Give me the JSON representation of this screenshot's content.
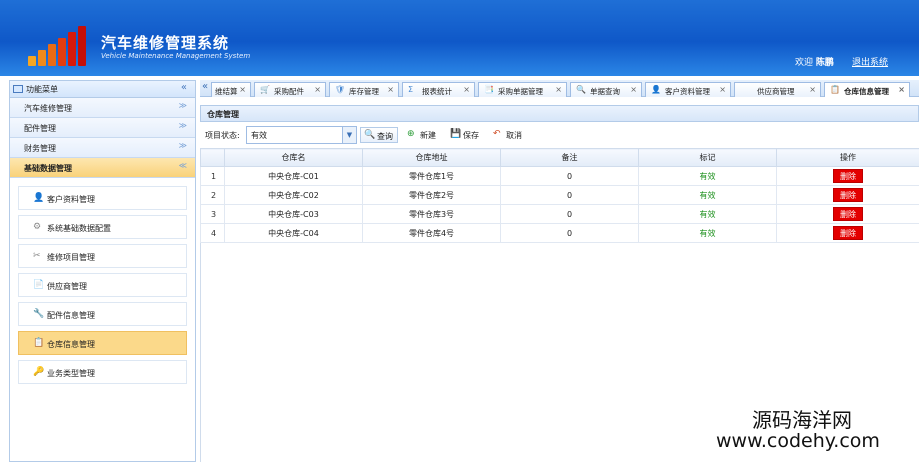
{
  "header": {
    "title_cn": "汽车维修管理系统",
    "title_en": "Vehicle Maintenance Management System",
    "welcome_prefix": "欢迎",
    "user": "陈鹏",
    "logout": "退出系统"
  },
  "sidebar": {
    "title": "功能菜单",
    "collapse": "«",
    "categories": [
      {
        "label": "汽车维修管理",
        "chev": "≫"
      },
      {
        "label": "配件管理",
        "chev": "≫"
      },
      {
        "label": "财务管理",
        "chev": "≫"
      },
      {
        "label": "基础数据管理",
        "chev": "≪"
      }
    ],
    "items": [
      {
        "label": "客户资料管理",
        "icon": "👤"
      },
      {
        "label": "系统基础数据配置",
        "icon": "⚙"
      },
      {
        "label": "维修项目管理",
        "icon": "✂"
      },
      {
        "label": "供应商管理",
        "icon": "📄"
      },
      {
        "label": "配件信息管理",
        "icon": "🔧"
      },
      {
        "label": "仓库信息管理",
        "icon": "📋"
      },
      {
        "label": "业务类型管理",
        "icon": "🔑"
      }
    ]
  },
  "tabs": [
    {
      "label": "维结算",
      "icon": "",
      "close": "×"
    },
    {
      "label": "采购配件",
      "icon": "🛒",
      "close": "×"
    },
    {
      "label": "库存管理",
      "icon": "🛡",
      "close": "×"
    },
    {
      "label": "报表统计",
      "icon": "Σ",
      "close": "×"
    },
    {
      "label": "采购单据管理",
      "icon": "📑",
      "close": "×"
    },
    {
      "label": "单据查询",
      "icon": "🔍",
      "close": "×"
    },
    {
      "label": "客户资料管理",
      "icon": "👤",
      "close": "×"
    },
    {
      "label": "供应商管理",
      "icon": "",
      "close": "×"
    },
    {
      "label": "仓库信息管理",
      "icon": "📋",
      "close": "×"
    }
  ],
  "panel": {
    "title": "仓库管理"
  },
  "toolbar": {
    "status_label": "项目状态:",
    "status_value": "有效",
    "query": "查询",
    "new": "新建",
    "save": "保存",
    "cancel": "取消"
  },
  "grid": {
    "headers": [
      "仓库名",
      "仓库地址",
      "备注",
      "标记",
      "操作"
    ],
    "rows": [
      {
        "no": "1",
        "name": "中央仓库-C01",
        "addr": "零件仓库1号",
        "note": "0",
        "flag": "有效",
        "action": "删除"
      },
      {
        "no": "2",
        "name": "中央仓库-C02",
        "addr": "零件仓库2号",
        "note": "0",
        "flag": "有效",
        "action": "删除"
      },
      {
        "no": "3",
        "name": "中央仓库-C03",
        "addr": "零件仓库3号",
        "note": "0",
        "flag": "有效",
        "action": "删除"
      },
      {
        "no": "4",
        "name": "中央仓库-C04",
        "addr": "零件仓库4号",
        "note": "0",
        "flag": "有效",
        "action": "删除"
      }
    ]
  },
  "watermark": {
    "cn": "源码海洋网",
    "en": "www.codehy.com"
  }
}
